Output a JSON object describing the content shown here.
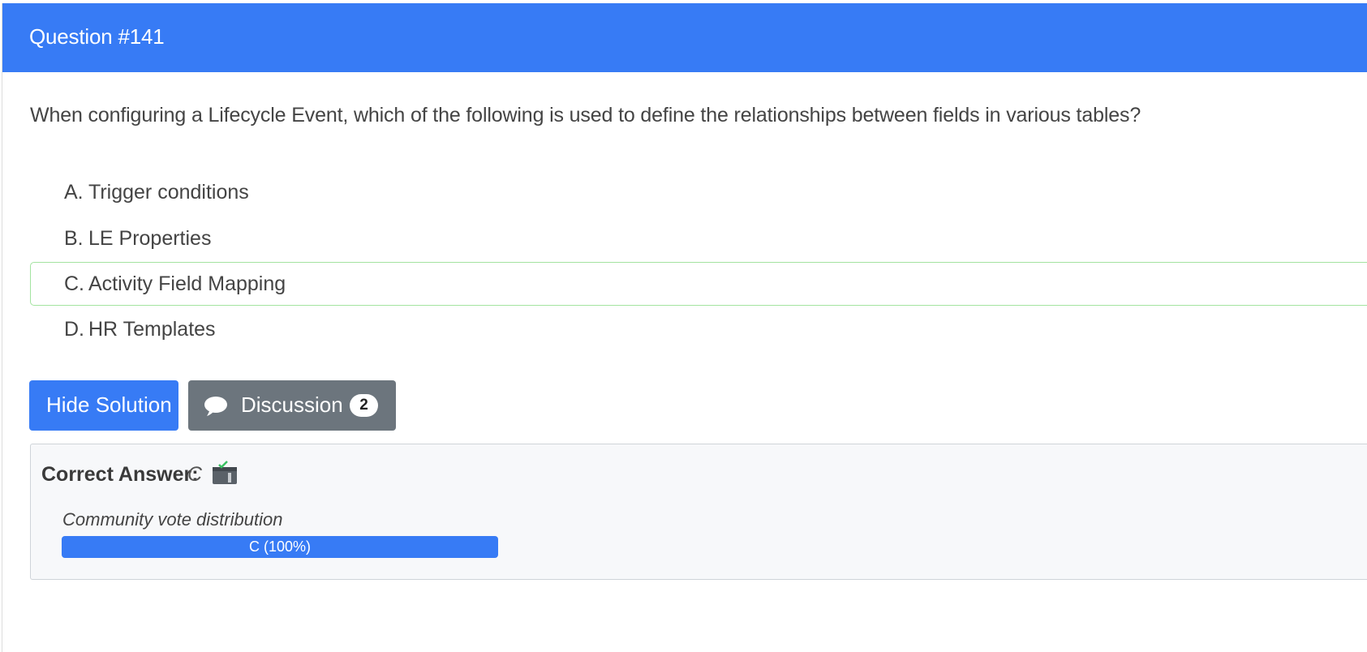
{
  "header": {
    "title": "Question #141",
    "color": "#377bf5"
  },
  "question": {
    "text": "When configuring a Lifecycle Event, which of the following is used to define the relationships between fields in various tables?"
  },
  "choices": [
    {
      "letter": "A.",
      "text": "Trigger conditions",
      "correct": false
    },
    {
      "letter": "B.",
      "text": "LE Properties",
      "correct": false
    },
    {
      "letter": "C.",
      "text": "Activity Field Mapping",
      "correct": true
    },
    {
      "letter": "D.",
      "text": "HR Templates",
      "correct": false
    }
  ],
  "buttons": {
    "hide_solution": "Hide Solution",
    "discussion": "Discussion",
    "discussion_count": "2",
    "discussion_icon": "comment-icon"
  },
  "answer": {
    "label": "Correct Answer:",
    "value": "C",
    "icon": "answer-clipboard-icon",
    "vote_label": "Community vote distribution",
    "vote_bar_text": "C (100%)",
    "vote_percent": 100,
    "vote_color": "#377bf5"
  }
}
